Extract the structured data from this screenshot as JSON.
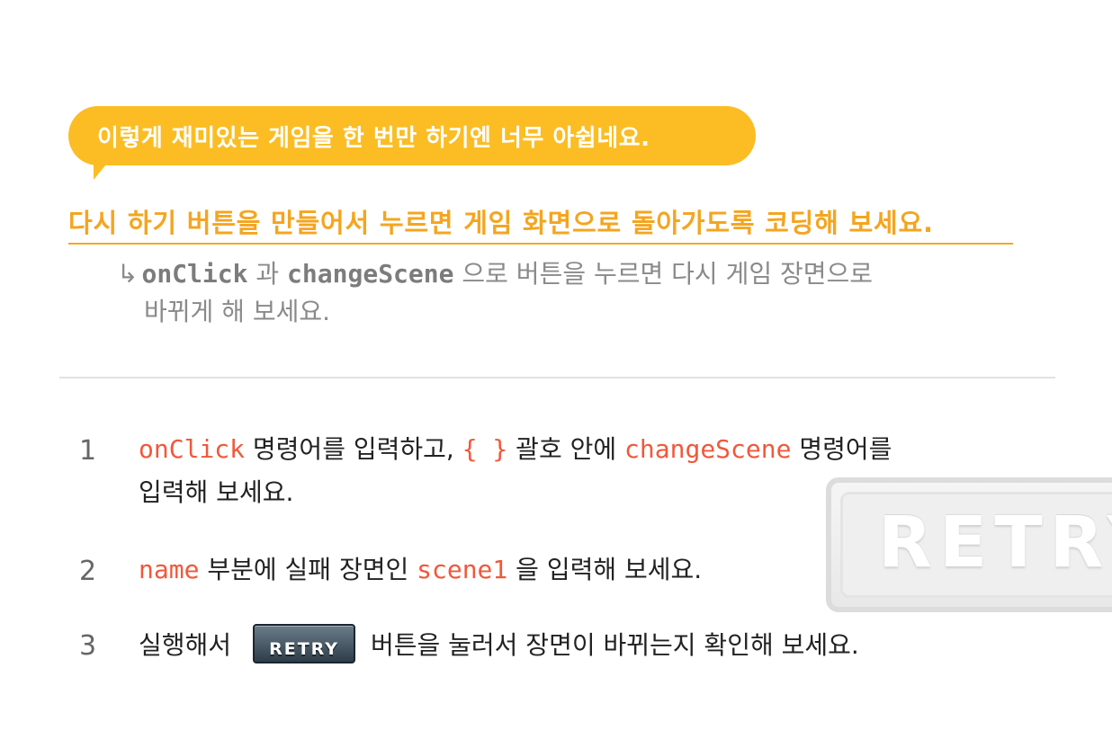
{
  "bubble": {
    "text": "이렇게 재미있는 게임을 한 번만 하기엔 너무 아쉽네요.",
    "color": "#fbbd23"
  },
  "mission": {
    "text": "다시 하기 버튼을 만들어서 누르면 게임 화면으로 돌아가도록 코딩해 보세요.",
    "color": "#f4a51f"
  },
  "hint": {
    "arrow": "↳",
    "code1": "onClick",
    "text1": " 과 ",
    "code2": "changeScene",
    "text2": " 으로 버튼을 누르면 다시 게임 장면으로",
    "line2": "바뀌게 해 보세요."
  },
  "steps": [
    {
      "number": "1",
      "code1": "onClick",
      "text1": " 명령어를 입력하고, ",
      "code2": "{ }",
      "text2": " 괄호 안에 ",
      "code3": "changeScene",
      "text3": " 명령어를",
      "line2": "입력해 보세요."
    },
    {
      "number": "2",
      "code1": "name",
      "text1": " 부분에 실패 장면인 ",
      "code2": "scene1",
      "text2": " 을 입력해 보세요."
    },
    {
      "number": "3",
      "text1": "실행해서",
      "button_label": "RETRY",
      "text2": " 버튼을 눌러서 장면이 바뀌는지 확인해 보세요."
    }
  ],
  "retry_button_preview": {
    "label": "RETRY"
  },
  "colors": {
    "code": "#f1583b",
    "divider": "#e2e2e2"
  }
}
